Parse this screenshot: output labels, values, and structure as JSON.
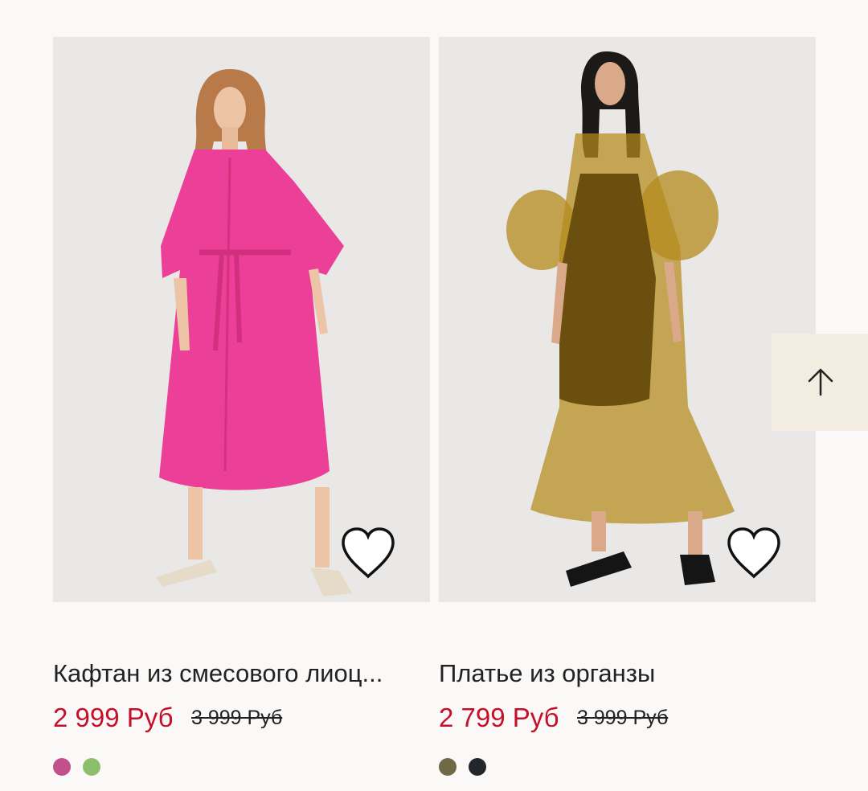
{
  "products": [
    {
      "title": "Кафтан из смесового лиоц...",
      "price_sale": "2 999 Руб",
      "price_old": "3 999 Руб",
      "image_icon": "pink-kaftan-dress-image",
      "favorite_icon": "heart-outline-icon",
      "swatches": [
        {
          "color": "#c2508a",
          "name": "pink-swatch"
        },
        {
          "color": "#8bbf6a",
          "name": "green-swatch"
        }
      ]
    },
    {
      "title": "Платье из органзы",
      "price_sale": "2 799 Руб",
      "price_old": "3 999 Руб",
      "image_icon": "olive-organza-dress-image",
      "favorite_icon": "heart-outline-icon",
      "swatches": [
        {
          "color": "#6e6a45",
          "name": "olive-swatch"
        },
        {
          "color": "#23262a",
          "name": "black-swatch"
        }
      ]
    }
  ],
  "scroll_top": {
    "icon": "arrow-up-icon"
  },
  "colors": {
    "background": "#faf9f8",
    "sale_price": "#c5102b",
    "scroll_button": "#f3ece0",
    "photo_bg": "#e9e8e7"
  }
}
